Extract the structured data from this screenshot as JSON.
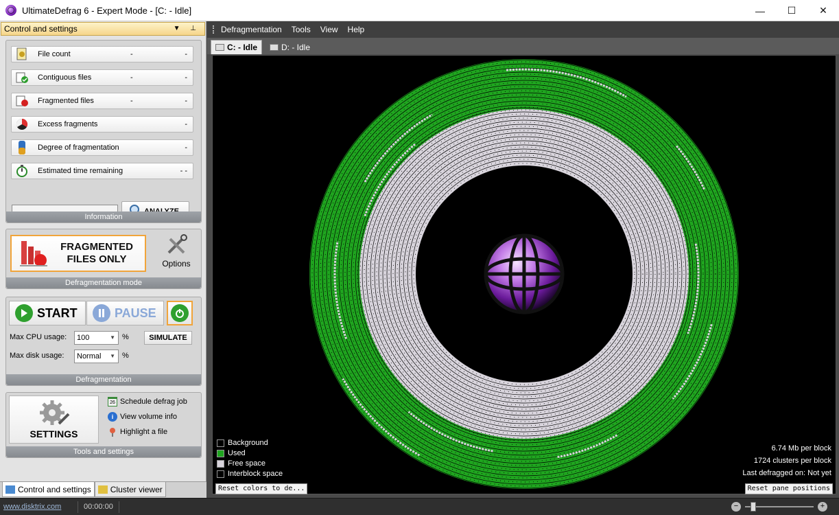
{
  "window": {
    "title": "UltimateDefrag 6 - Expert Mode - [C: - Idle]",
    "minimize": "—",
    "maximize": "☐",
    "close": "✕"
  },
  "panel": {
    "header": "Control and settings",
    "header_buttons": "▼ ⊥"
  },
  "info": {
    "title": "Information",
    "rows": [
      {
        "label": "File count",
        "value": "-",
        "value2": "-",
        "icon": "file-count-icon"
      },
      {
        "label": "Contiguous files",
        "value": "-",
        "value2": "-",
        "icon": "contiguous-files-icon"
      },
      {
        "label": "Fragmented files",
        "value": "-",
        "value2": "-",
        "icon": "fragmented-files-icon"
      },
      {
        "label": "Excess fragments",
        "value": "",
        "value2": "-",
        "icon": "excess-fragments-icon"
      },
      {
        "label": "Degree of fragmentation",
        "value": "",
        "value2": "-",
        "icon": "degree-fragmentation-icon"
      },
      {
        "label": "Estimated time remaining",
        "value": "",
        "value2": "- -",
        "icon": "stopwatch-icon"
      }
    ],
    "analyze_label": "ANALYZE"
  },
  "mode": {
    "title": "Defragmentation mode",
    "button_line1": "FRAGMENTED",
    "button_line2": "FILES ONLY",
    "options_label": "Options"
  },
  "defrag": {
    "title": "Defragmentation",
    "start_label": "START",
    "pause_label": "PAUSE",
    "cpu_label": "Max CPU usage:",
    "cpu_value": "100",
    "cpu_unit": "%",
    "disk_label": "Max disk usage:",
    "disk_value": "Normal",
    "disk_unit": "%",
    "simulate_label": "SIMULATE"
  },
  "tools": {
    "title": "Tools and settings",
    "settings_label": "SETTINGS",
    "links": [
      "Schedule defrag job",
      "View volume info",
      "Highlight a file"
    ],
    "calendar_day": "26"
  },
  "bottom_tabs": [
    "Control and settings",
    "Cluster viewer"
  ],
  "menu": [
    "Defragmentation",
    "Tools",
    "View",
    "Help"
  ],
  "doc_tabs": [
    "C: - Idle",
    "D: - Idle"
  ],
  "legend": [
    {
      "label": "Background",
      "color": "#000000"
    },
    {
      "label": "Used",
      "color": "#1fa51f"
    },
    {
      "label": "Free space",
      "color": "#d8d4dc"
    },
    {
      "label": "Interblock space",
      "color": "#000000"
    }
  ],
  "map_info": [
    "6.74 Mb per block",
    "1724 clusters per block",
    "Last defragged on: Not yet"
  ],
  "map_buttons": {
    "reset_colors": "Reset colors to de...",
    "reset_pane": "Reset pane positions"
  },
  "status": {
    "link": "www.disktrix.com",
    "time": "00:00:00"
  },
  "colors": {
    "used": "#1fa51f",
    "free": "#d8d4dc",
    "accent": "#f1a43a"
  }
}
